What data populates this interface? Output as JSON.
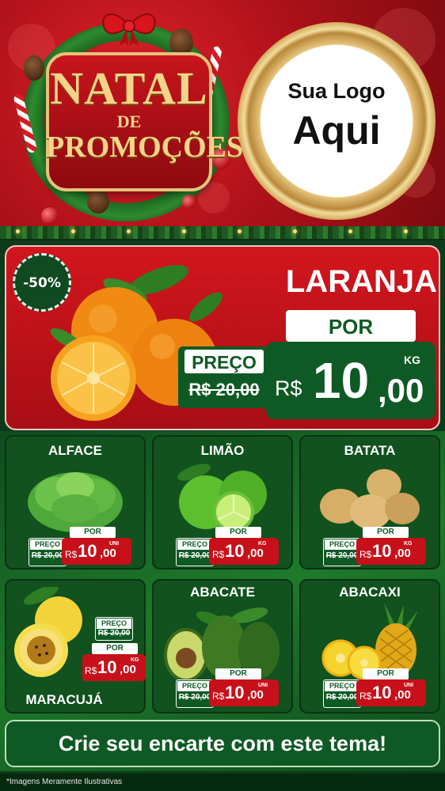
{
  "header": {
    "title_top": "NATAL",
    "title_mid": "DE",
    "title_bottom": "PROMOÇÕES",
    "logo_line1": "Sua Logo",
    "logo_line2": "Aqui"
  },
  "featured": {
    "discount": "-50%",
    "name": "LARANJA",
    "por_label": "POR",
    "preco_label": "PREÇO",
    "old_price": "R$ 20,00",
    "currency": "R$",
    "price_int": "10",
    "price_dec": ",00",
    "unit": "KG"
  },
  "products": [
    {
      "name": "ALFACE",
      "preco_label": "PREÇO",
      "old_price": "R$ 20,00",
      "por_label": "POR",
      "currency": "R$",
      "price_int": "10",
      "price_dec": ",00",
      "unit": "UNI"
    },
    {
      "name": "LIMÃO",
      "preco_label": "PREÇO",
      "old_price": "R$ 20,00",
      "por_label": "POR",
      "currency": "R$",
      "price_int": "10",
      "price_dec": ",00",
      "unit": "KG"
    },
    {
      "name": "BATATA",
      "preco_label": "PREÇO",
      "old_price": "R$ 20,00",
      "por_label": "POR",
      "currency": "R$",
      "price_int": "10",
      "price_dec": ",00",
      "unit": "KG"
    },
    {
      "name": "MARACUJÁ",
      "preco_label": "PREÇO",
      "old_price": "R$ 20,00",
      "por_label": "POR",
      "currency": "R$",
      "price_int": "10",
      "price_dec": ",00",
      "unit": "KG"
    },
    {
      "name": "ABACATE",
      "preco_label": "PREÇO",
      "old_price": "R$ 20,00",
      "por_label": "POR",
      "currency": "R$",
      "price_int": "10",
      "price_dec": ",00",
      "unit": "UNI"
    },
    {
      "name": "ABACAXI",
      "preco_label": "PREÇO",
      "old_price": "R$ 20,00",
      "por_label": "POR",
      "currency": "R$",
      "price_int": "10",
      "price_dec": ",00",
      "unit": "UNI"
    }
  ],
  "cta": "Crie seu encarte com este tema!",
  "footer": {
    "disclaimer": "*Imagens Meramente Ilustrativas"
  },
  "colors": {
    "brand_red": "#c8101a",
    "brand_green": "#0f5a24",
    "gold": "#f5d48a"
  }
}
